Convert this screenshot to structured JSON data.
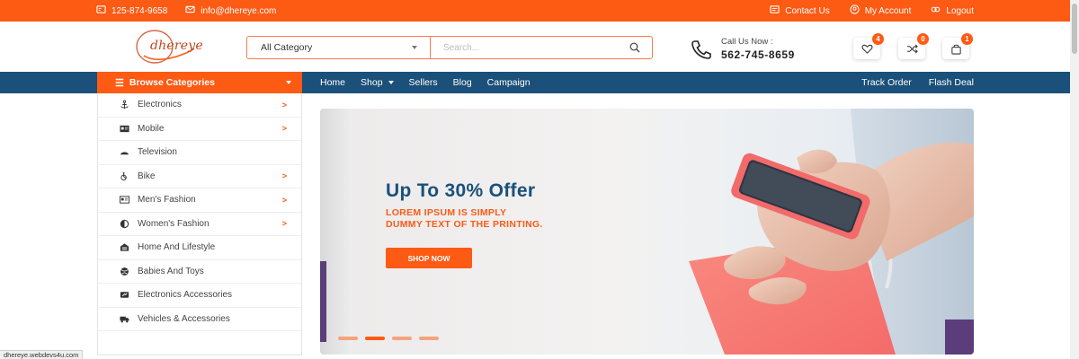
{
  "topbar": {
    "phone": "125-874-9658",
    "email": "info@dhereye.com",
    "links": {
      "contact": "Contact Us",
      "account": "My Account",
      "logout": "Logout"
    }
  },
  "header": {
    "logo_text": "dhereye",
    "search": {
      "category": "All Category",
      "placeholder": "Search..."
    },
    "call": {
      "label": "Call Us Now :",
      "number": "562-745-8659"
    },
    "wishlist_count": "4",
    "compare_count": "0",
    "cart_count": "1"
  },
  "nav": {
    "browse_label": "Browse Categories",
    "items": [
      "Home",
      "Shop",
      "Sellers",
      "Blog",
      "Campaign"
    ],
    "right": [
      "Track Order",
      "Flash Deal"
    ]
  },
  "categories": [
    {
      "label": "Electronics",
      "icon": "anchor-icon",
      "arrow": ">"
    },
    {
      "label": "Mobile",
      "icon": "id-card-icon",
      "arrow": ">"
    },
    {
      "label": "Television",
      "icon": "tv-icon",
      "arrow": ""
    },
    {
      "label": "Bike",
      "icon": "bike-icon",
      "arrow": ">"
    },
    {
      "label": "Men's Fashion",
      "icon": "address-card-icon",
      "arrow": ">"
    },
    {
      "label": "Women's Fashion",
      "icon": "half-circle-icon",
      "arrow": ">"
    },
    {
      "label": "Home And Lifestyle",
      "icon": "home-icon",
      "arrow": ""
    },
    {
      "label": "Babies And Toys",
      "icon": "ball-icon",
      "arrow": ""
    },
    {
      "label": "Electronics Accessories",
      "icon": "plug-icon",
      "arrow": ""
    },
    {
      "label": "Vehicles & Accessories",
      "icon": "truck-icon",
      "arrow": ""
    }
  ],
  "banner": {
    "title": "Up To 30% Offer",
    "subtitle_line1": "LOREM IPSUM IS SIMPLY",
    "subtitle_line2": "DUMMY TEXT OF THE PRINTING.",
    "button": "SHOP NOW",
    "active_slide": 2,
    "slide_count": 4
  },
  "status_url": "dhereye.webdevs4u.com",
  "colors": {
    "accent": "#fd5a14",
    "nav_blue": "#1a5079"
  }
}
